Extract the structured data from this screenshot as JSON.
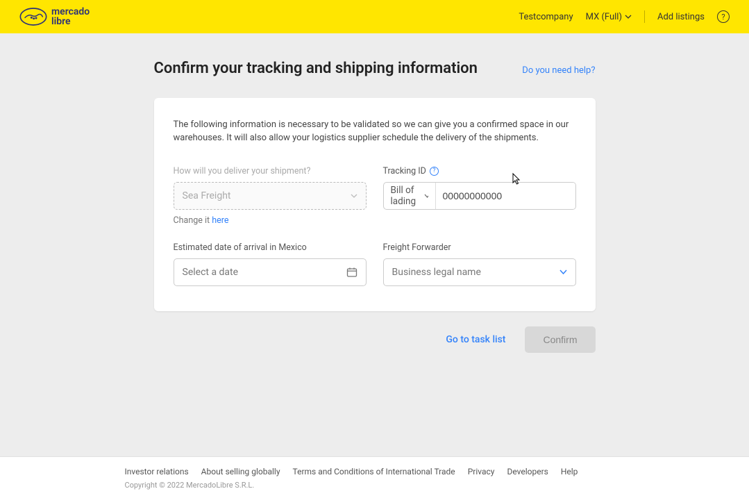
{
  "header": {
    "brand1": "mercado",
    "brand2": "libre",
    "company": "Testcompany",
    "region": "MX (Full)",
    "addListings": "Add listings",
    "helpGlyph": "?"
  },
  "page": {
    "title": "Confirm your tracking and shipping information",
    "helpLink": "Do you need help?",
    "intro": "The following information is necessary to be validated so we can give you a confirmed space in our warehouses. It will also allow your logistics supplier schedule the delivery of the shipments."
  },
  "form": {
    "deliveryLabel": "How will you deliver your shipment?",
    "deliveryValue": "Sea Freight",
    "changePrefix": "Change it ",
    "changeLink": "here",
    "trackingLabel": "Tracking ID",
    "trackingTypeValue": "Bill of lading",
    "trackingIdValue": "00000000000",
    "etaLabel": "Estimated date of arrival in Mexico",
    "etaPlaceholder": "Select a date",
    "ffLabel": "Freight Forwarder",
    "ffPlaceholder": "Business legal name"
  },
  "actions": {
    "taskList": "Go to task list",
    "confirm": "Confirm"
  },
  "footer": {
    "links": [
      "Investor relations",
      "About selling globally",
      "Terms and Conditions of International Trade",
      "Privacy",
      "Developers",
      "Help"
    ],
    "copyright": "Copyright © 2022 MercadoLibre S.R.L."
  }
}
